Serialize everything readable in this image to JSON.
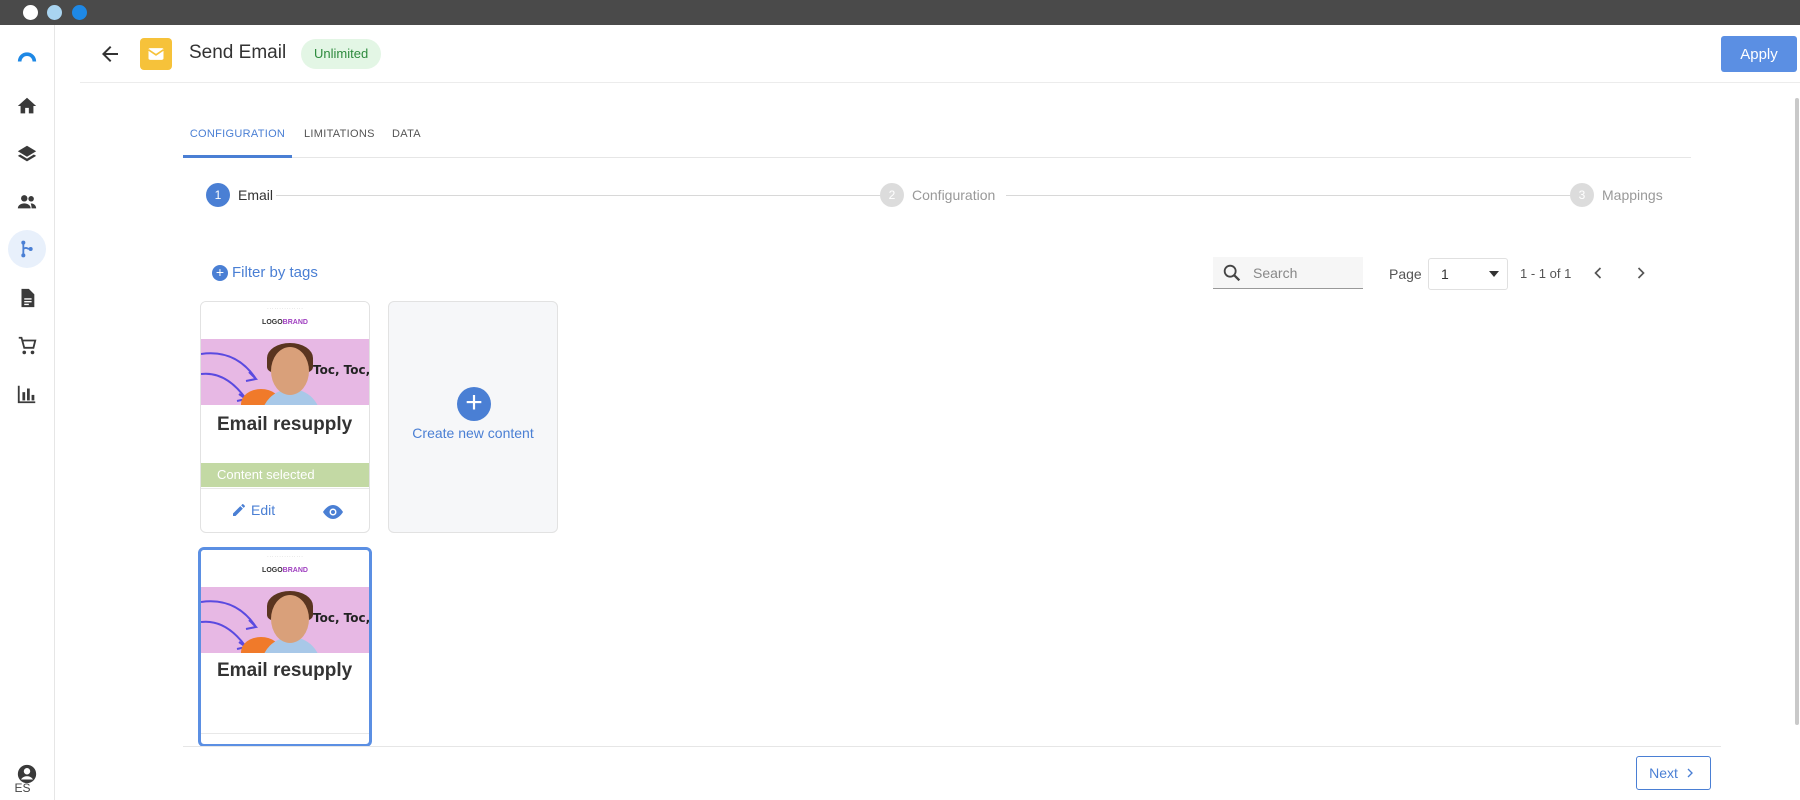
{
  "window": {
    "dots": [
      "close",
      "minimize",
      "maximize"
    ]
  },
  "sidebar": {
    "icons": [
      "brand-logo-icon",
      "home-icon",
      "layers-icon",
      "people-icon",
      "flow-icon",
      "document-icon",
      "cart-icon",
      "bar-chart-icon"
    ],
    "active_index": 4,
    "language": "ES"
  },
  "header": {
    "title": "Send Email",
    "badge": "Unlimited",
    "apply_label": "Apply"
  },
  "tabs": [
    {
      "label": "CONFIGURATION",
      "active": true
    },
    {
      "label": "LIMITATIONS",
      "active": false
    },
    {
      "label": "DATA",
      "active": false
    }
  ],
  "stepper": [
    {
      "number": "1",
      "label": "Email",
      "active": true
    },
    {
      "number": "2",
      "label": "Configuration",
      "active": false
    },
    {
      "number": "3",
      "label": "Mappings",
      "active": false
    }
  ],
  "toolbar": {
    "filter_label": "Filter by tags",
    "search_placeholder": "Search",
    "page_label": "Page",
    "page_value": "1",
    "page_range": "1 - 1 of 1"
  },
  "cards": [
    {
      "title": "Email resupply",
      "thumb_logo": "LOGO",
      "thumb_brand": "BRAND",
      "thumb_headline": "Toc, Toc, To",
      "status": "Content selected",
      "edit_label": "Edit"
    },
    {
      "title": "Email resupply",
      "thumb_logo": "LOGO",
      "thumb_brand": "BRAND",
      "thumb_headline": "Toc, Toc, To"
    }
  ],
  "create": {
    "label": "Create new content"
  },
  "footer": {
    "next_label": "Next"
  },
  "colors": {
    "accent": "#4a7fd4",
    "apply": "#5b8fe3",
    "badge_bg": "#e3f6e5",
    "badge_text": "#2e8b3e",
    "selected_bar": "#c3d9a4",
    "app_icon": "#f6c23a"
  }
}
